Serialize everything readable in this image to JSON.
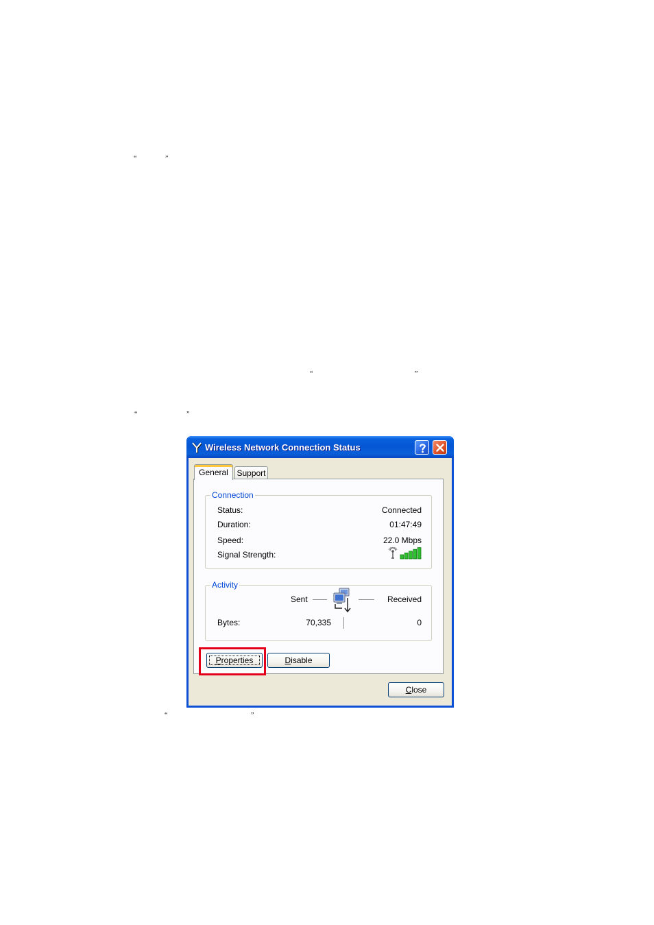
{
  "document": {
    "quote_pairs": [
      {
        "open": "“",
        "close": "”"
      },
      {
        "open": "“",
        "close": "”"
      },
      {
        "open": "“",
        "close": "”"
      },
      {
        "open": "“",
        "close": "”"
      }
    ]
  },
  "dialog": {
    "title": "Wireless Network Connection Status",
    "title_icon": "wireless-antenna-icon",
    "title_buttons": {
      "help_icon": "help-icon",
      "close_icon": "close-icon"
    },
    "tabs": [
      {
        "label": "General",
        "selected": true
      },
      {
        "label": "Support",
        "selected": false
      }
    ],
    "connection": {
      "legend": "Connection",
      "rows": [
        {
          "label": "Status:",
          "value": "Connected"
        },
        {
          "label": "Duration:",
          "value": "01:47:49"
        },
        {
          "label": "Speed:",
          "value": "22.0 Mbps"
        },
        {
          "label": "Signal Strength:",
          "value_icon": "signal-strength-icon"
        }
      ],
      "signal": {
        "bars": 5,
        "bars_max": 5
      }
    },
    "activity": {
      "legend": "Activity",
      "sent_label": "Sent",
      "received_label": "Received",
      "icon": "network-activity-icon",
      "bytes_label": "Bytes:",
      "bytes_sent": "70,335",
      "bytes_received": "0"
    },
    "buttons": {
      "properties": "Properties",
      "disable": "Disable",
      "close": "Close"
    },
    "highlight": {
      "target": "properties-button"
    }
  },
  "colors": {
    "title_bar": "#0a5fd8",
    "dialog_face": "#ece9d8",
    "group_legend": "#0046d5",
    "highlight": "#e4001b",
    "signal_on": "#2fbf2f",
    "signal_off": "#c8c8c8"
  }
}
